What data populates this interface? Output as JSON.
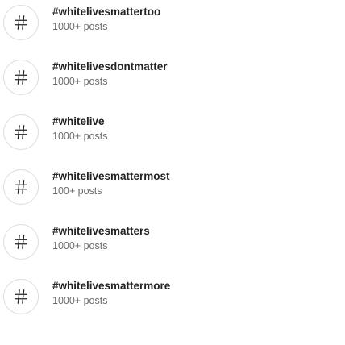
{
  "hashtags": [
    {
      "tag": "#whitelivesmattertoo",
      "count": "1000+ posts",
      "icon": "hashtag-icon"
    },
    {
      "tag": "#whitelivesdontmatter",
      "count": "1000+ posts",
      "icon": "hashtag-icon"
    },
    {
      "tag": "#whitelive",
      "count": "1000+ posts",
      "icon": "hashtag-icon"
    },
    {
      "tag": "#whitelivesmattermost",
      "count": "100+ posts",
      "icon": "hashtag-icon"
    },
    {
      "tag": "#whitelivesmatters",
      "count": "1000+ posts",
      "icon": "hashtag-icon"
    },
    {
      "tag": "#whitelivesmattermore",
      "count": "1000+ posts",
      "icon": "hashtag-icon"
    }
  ]
}
